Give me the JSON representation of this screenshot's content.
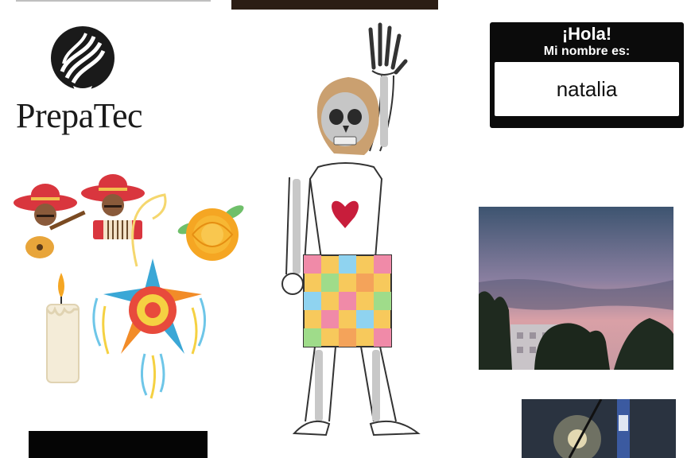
{
  "brand": {
    "name": "PrepaTec"
  },
  "name_tag": {
    "greeting": "¡Hola!",
    "subtitle": "Mi nombre es:",
    "name": "natalia"
  },
  "icons": {
    "logo": "prepatec-flame-logo",
    "mariachi": "mariachi-icon",
    "marigold": "marigold-flower-icon",
    "candle": "candle-icon",
    "pinata": "pinata-icon",
    "skeleton": "catrina-skeleton-illustration"
  },
  "photos": {
    "sunset": "sunset-photo",
    "night": "night-lights-photo"
  },
  "colors": {
    "sombrero": "#d9363e",
    "marigold": "#f5a623",
    "heart": "#c81d3b",
    "nametag": "#0b0b0b"
  }
}
